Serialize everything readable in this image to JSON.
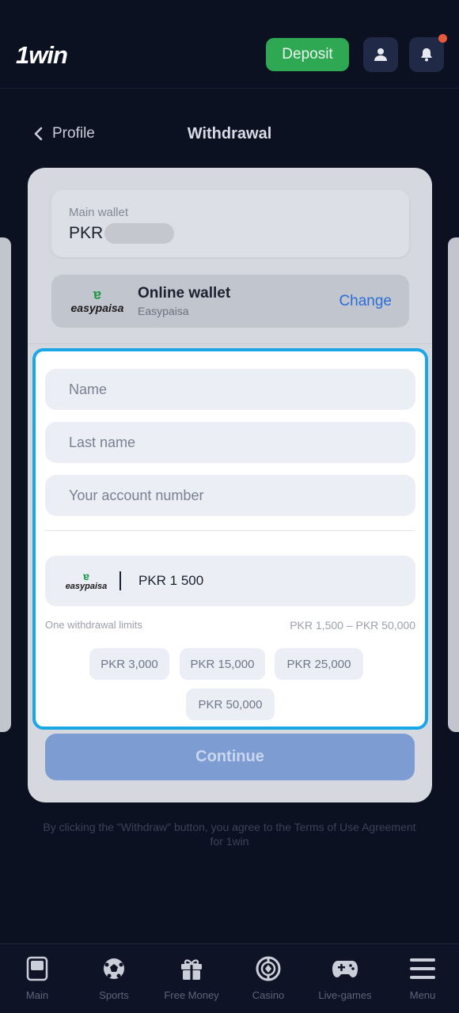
{
  "header": {
    "logo": "1win",
    "deposit_label": "Deposit",
    "profile_icon": "user-icon",
    "notification_icon": "bell-icon"
  },
  "nav": {
    "back_label": "Profile",
    "title": "Withdrawal"
  },
  "wallet": {
    "label": "Main wallet",
    "currency": "PKR"
  },
  "method": {
    "logo_text": "easypaisa",
    "title": "Online wallet",
    "subtitle": "Easypaisa",
    "change_label": "Change"
  },
  "form": {
    "name_placeholder": "Name",
    "last_name_placeholder": "Last name",
    "account_placeholder": "Your account number",
    "amount_logo_text": "easypaisa",
    "amount_value": "PKR 1 500",
    "limits_label": "One withdrawal limits",
    "limits_range": "PKR 1,500  –  PKR 50,000",
    "chips": [
      "PKR 3,000",
      "PKR 15,000",
      "PKR 25,000",
      "PKR 50,000"
    ]
  },
  "continue_label": "Continue",
  "terms": "By clicking the \"Withdraw\" button, you agree to the Terms of Use Agreement for 1win",
  "bottom_nav": [
    {
      "label": "Main",
      "icon": "main-icon"
    },
    {
      "label": "Sports",
      "icon": "soccer-ball-icon"
    },
    {
      "label": "Free Money",
      "icon": "gift-icon"
    },
    {
      "label": "Casino",
      "icon": "casino-chip-icon"
    },
    {
      "label": "Live-games",
      "icon": "gamepad-icon"
    },
    {
      "label": "Menu",
      "icon": "menu-icon"
    }
  ],
  "colors": {
    "background": "#0c1122",
    "deposit": "#2ea852",
    "accent_border": "#1aa7e6",
    "link": "#2a6dd8",
    "continue": "#7d9dd2"
  }
}
